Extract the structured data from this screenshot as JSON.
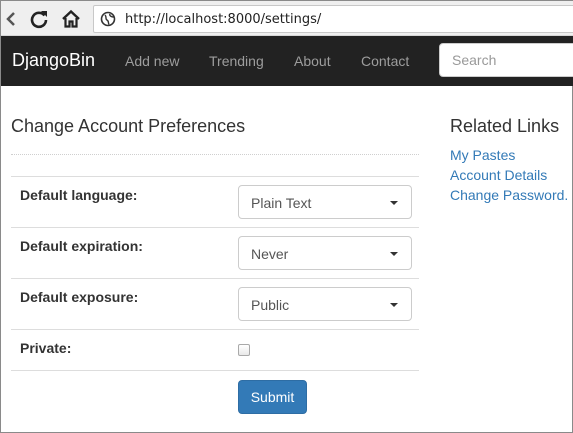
{
  "browser": {
    "url": "http://localhost:8000/settings/",
    "icons": [
      "back-arrow-icon",
      "reload-icon",
      "home-icon",
      "globe-icon"
    ]
  },
  "navbar": {
    "brand": "DjangoBin",
    "links": [
      "Add new",
      "Trending",
      "About",
      "Contact"
    ],
    "search_placeholder": "Search",
    "background": "#222222"
  },
  "main": {
    "title": "Change Account Preferences",
    "fields": [
      {
        "label": "Default language:",
        "value": "Plain Text"
      },
      {
        "label": "Default expiration:",
        "value": "Never"
      },
      {
        "label": "Default exposure:",
        "value": "Public"
      }
    ],
    "private": {
      "label": "Private:",
      "checked": false
    },
    "submit_label": "Submit"
  },
  "sidebar": {
    "title": "Related Links",
    "links": [
      "My Pastes",
      "Account Details",
      "Change Password."
    ]
  },
  "colors": {
    "link": "#337ab7",
    "primary_button": "#337ab7"
  }
}
